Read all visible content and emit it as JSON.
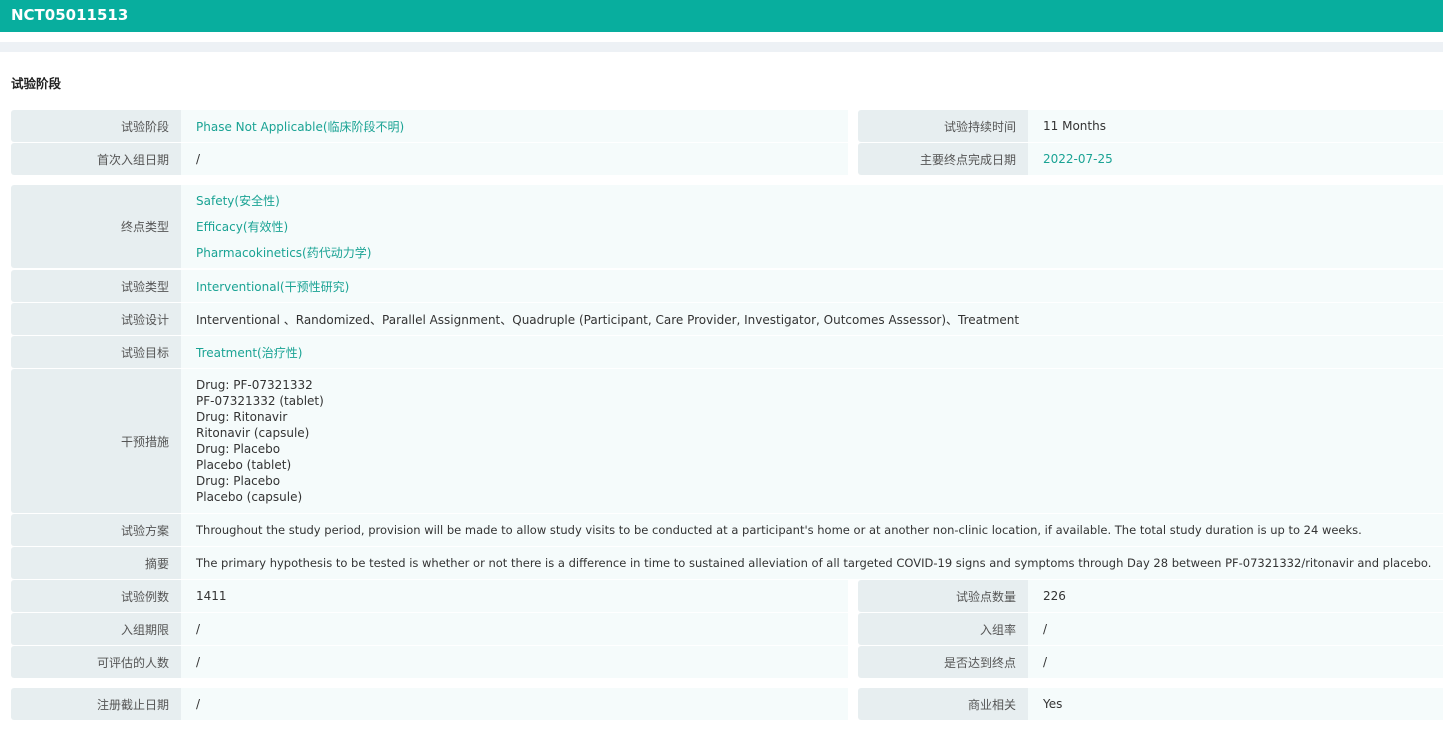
{
  "title": "NCT05011513",
  "section_title": "试验阶段",
  "phase": {
    "label": "试验阶段",
    "value": "Phase Not Applicable(临床阶段不明)"
  },
  "duration": {
    "label": "试验持续时间",
    "value": "11 Months"
  },
  "first_enroll": {
    "label": "首次入组日期",
    "value": "/"
  },
  "primary_completion": {
    "label": "主要终点完成日期",
    "value": "2022-07-25"
  },
  "endpoint_types": {
    "label": "终点类型",
    "values": [
      "Safety(安全性)",
      "Efficacy(有效性)",
      "Pharmacokinetics(药代动力学)"
    ]
  },
  "study_type": {
    "label": "试验类型",
    "value": "Interventional(干预性研究)"
  },
  "design": {
    "label": "试验设计",
    "value": "Interventional 、Randomized、Parallel Assignment、Quadruple (Participant, Care Provider, Investigator, Outcomes Assessor)、Treatment"
  },
  "purpose": {
    "label": "试验目标",
    "value": "Treatment(治疗性)"
  },
  "interventions": {
    "label": "干预措施",
    "values": [
      "Drug: PF-07321332",
      "PF-07321332 (tablet)",
      "Drug: Ritonavir",
      "Ritonavir (capsule)",
      "Drug: Placebo",
      "Placebo (tablet)",
      "Drug: Placebo",
      "Placebo (capsule)"
    ]
  },
  "plan": {
    "label": "试验方案",
    "value": "Throughout the study period, provision will be made to allow study visits to be conducted at a participant's home or at another non-clinic location, if available. The total study duration is up to 24 weeks."
  },
  "summary": {
    "label": "摘要",
    "value": "The primary hypothesis to be tested is whether or not there is a difference in time to sustained alleviation of all targeted COVID-19 signs and symptoms through Day 28 between PF-07321332/ritonavir and placebo."
  },
  "enrollment": {
    "label": "试验例数",
    "value": "1411"
  },
  "sites": {
    "label": "试验点数量",
    "value": "226"
  },
  "enroll_period": {
    "label": "入组期限",
    "value": "/"
  },
  "enroll_rate": {
    "label": "入组率",
    "value": "/"
  },
  "evaluable": {
    "label": "可评估的人数",
    "value": "/"
  },
  "endpoint_met": {
    "label": "是否达到终点",
    "value": "/"
  },
  "reg_deadline": {
    "label": "注册截止日期",
    "value": "/"
  },
  "commercial": {
    "label": "商业相关",
    "value": "Yes"
  }
}
